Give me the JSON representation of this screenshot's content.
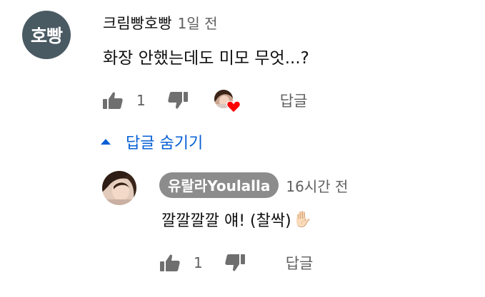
{
  "comment": {
    "avatar_text": "호빵",
    "author": "크림빵호빵",
    "time": "1일 전",
    "text": "화장 안했는데도 미모 무엇...?",
    "like_count": "1",
    "reply_label": "답글",
    "icons": [
      "thumbs-up-icon",
      "thumbs-down-icon",
      "creator-heart-icon"
    ]
  },
  "replies_toggle": {
    "label": "답글 숨기기",
    "icon": "caret-up-icon"
  },
  "reply": {
    "author": "유랄라Youlalla",
    "time": "16시간 전",
    "text": "깔깔깔깔 얘! (찰싹)",
    "emoji": "✋🏻",
    "like_count": "1",
    "reply_label": "답글",
    "icons": [
      "thumbs-up-icon",
      "thumbs-down-icon"
    ]
  },
  "colors": {
    "link_blue": "#065fd4",
    "secondary_text": "#606060",
    "heart_red": "#ff0000",
    "author_chip_bg": "#8c8c8c"
  }
}
